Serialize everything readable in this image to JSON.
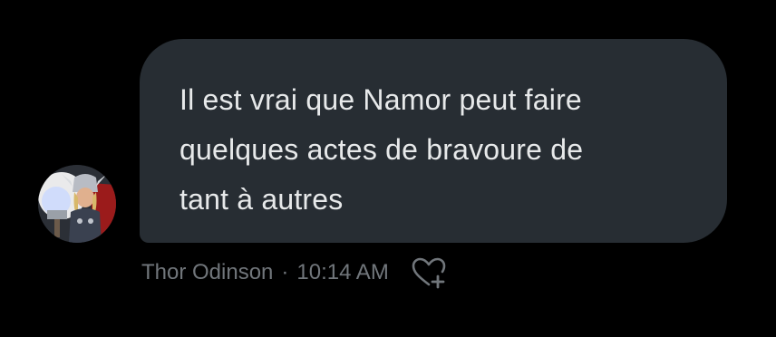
{
  "message": {
    "text": "Il est vrai que Namor peut faire\nquelques actes de bravoure de\ntant à autres",
    "sender": "Thor Odinson",
    "separator": "·",
    "time": "10:14 AM"
  },
  "icons": {
    "avatar": "avatar-image",
    "reaction": "heart-plus-icon"
  },
  "colors": {
    "background": "#000000",
    "bubble": "#272d33",
    "text": "#e7e9ea",
    "meta": "#71767b"
  }
}
